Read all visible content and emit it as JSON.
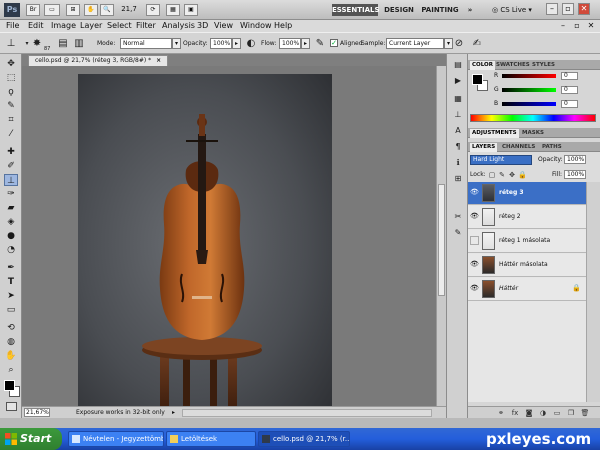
{
  "app": {
    "logo": "Ps",
    "zoom": "21,7",
    "workspaces": [
      "ESSENTIALS",
      "DESIGN",
      "PAINTING"
    ],
    "more": "»",
    "cslive": "CS Live",
    "minimize": "–",
    "restore": "▫",
    "close": "✕"
  },
  "menu": [
    "File",
    "Edit",
    "Image",
    "Layer",
    "Select",
    "Filter",
    "Analysis",
    "3D",
    "View",
    "Window",
    "Help"
  ],
  "options": {
    "brush_size": "87",
    "mode_label": "Mode:",
    "mode_value": "Normal",
    "opacity_label": "Opacity:",
    "opacity_value": "100%",
    "flow_label": "Flow:",
    "flow_value": "100%",
    "aligned_label": "Aligned",
    "sample_label": "Sample:",
    "sample_value": "Current Layer"
  },
  "document": {
    "tab_title": "cello.psd @ 21,7% (réteg 3, RGB/8#) *",
    "tab_close": "×",
    "zoom": "21,67%",
    "status": "Exposure works in 32-bit only",
    "status_arrow": "▸"
  },
  "color_panel": {
    "tabs": [
      "COLOR",
      "SWATCHES",
      "STYLES"
    ],
    "channels": [
      {
        "label": "R",
        "value": "0",
        "color": "#d02020"
      },
      {
        "label": "G",
        "value": "0",
        "color": "#20a020"
      },
      {
        "label": "B",
        "value": "0",
        "color": "#2030d0"
      }
    ]
  },
  "adjustments_tabs": [
    "ADJUSTMENTS",
    "MASKS"
  ],
  "layers_panel": {
    "tabs": [
      "LAYERS",
      "CHANNELS",
      "PATHS"
    ],
    "blend_mode": "Hard Light",
    "opacity_label": "Opacity:",
    "opacity_value": "100%",
    "lock_label": "Lock:",
    "fill_label": "Fill:",
    "fill_value": "100%",
    "layers": [
      {
        "name": "réteg 3",
        "visible": true,
        "selected": true
      },
      {
        "name": "réteg 2",
        "visible": true,
        "selected": false
      },
      {
        "name": "réteg 1 másolata",
        "visible": false,
        "selected": false
      },
      {
        "name": "Háttér másolata",
        "visible": true,
        "selected": false
      },
      {
        "name": "Háttér",
        "visible": true,
        "selected": false,
        "locked": true
      }
    ]
  },
  "taskbar": {
    "start": "Start",
    "items": [
      {
        "label": "Névtelen - Jegyzettömb",
        "active": false
      },
      {
        "label": "Letöltések",
        "active": false
      },
      {
        "label": "cello.psd @ 21,7% (r...",
        "active": true
      }
    ],
    "watermark": "pxleyes.com"
  }
}
